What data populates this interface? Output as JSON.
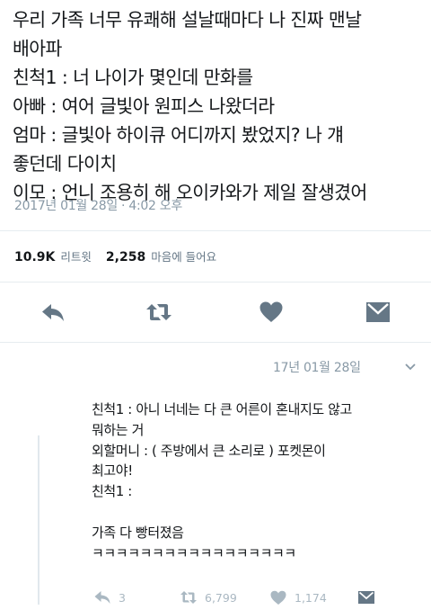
{
  "tweet": {
    "lines": [
      "우리 가족 너무 유쾌해 설날때마다 나 진짜 맨날",
      "배아파",
      "친척1 : 너 나이가 몇인데 만화를",
      "아빠 : 여어 글빛아 원피스 나왔더라",
      "엄마 : 글빛아 하이큐 어디까지 봤었지? 나 걔",
      "좋던데 다이치",
      "이모 : 언니 조용히 해 오이카와가 제일 잘생겼어"
    ],
    "timestamp": "2017년 01월 28일 · 4:02 오후",
    "retweets_count": "10.9K",
    "retweets_label": "리트윗",
    "likes_count": "2,258",
    "likes_label": "마음에 들어요"
  },
  "actions": [
    {
      "icon": "reply-icon"
    },
    {
      "icon": "retweet-icon"
    },
    {
      "icon": "heart-icon"
    },
    {
      "icon": "direct-message-icon"
    }
  ],
  "reply": {
    "date": "17년 01월 28일",
    "lines": [
      "친척1 : 아니 너네는 다 큰 어른이 혼내지도 않고",
      "뭐하는 거",
      "외할머니 : ( 주방에서 큰 소리로 ) 포켓몬이",
      "최고야!",
      "친척1 :",
      "",
      "가족 다 빵터졌음",
      "ㅋㅋㅋㅋㅋㅋㅋㅋㅋㅋㅋㅋㅋㅋㅋㅋㅋ"
    ],
    "reply_count": "3",
    "retweet_count": "6,799",
    "like_count": "1,174"
  },
  "colors": {
    "icon": "#657786",
    "muted": "#8899a6",
    "divider": "#e6ecf0"
  }
}
